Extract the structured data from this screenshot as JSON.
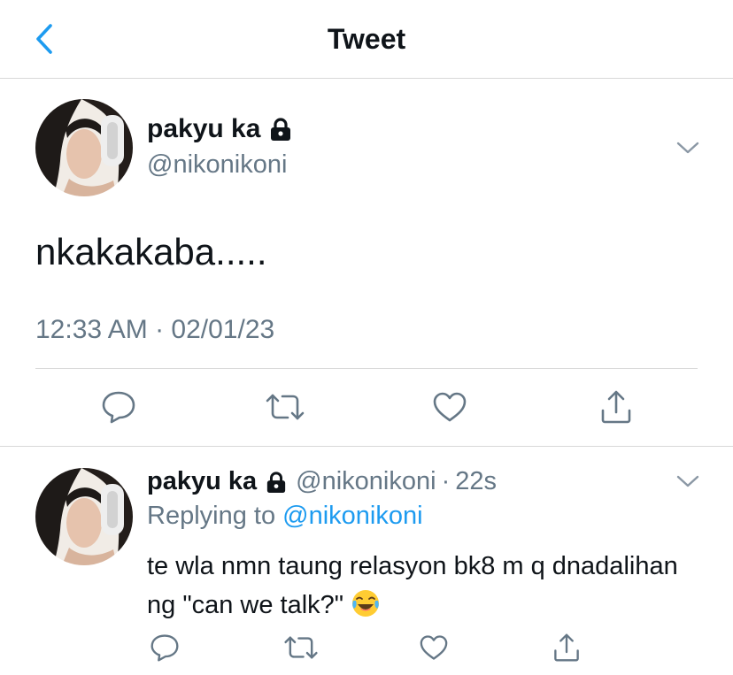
{
  "header": {
    "title": "Tweet",
    "back_icon": "chevron-left-icon"
  },
  "tweet": {
    "name": "pakyu ka",
    "handle": "@nikonikoni",
    "text": "nkakakaba.....",
    "timestamp": "12:33 AM · 02/01/23",
    "actions": [
      "reply-icon",
      "retweet-icon",
      "like-icon",
      "share-icon"
    ]
  },
  "reply": {
    "name": "pakyu ka",
    "handle": "@nikonikoni",
    "dot": "·",
    "time": "22s",
    "replying_prefix": "Replying to",
    "replying_to": "@nikonikoni",
    "text": "te wla nmn taung relasyon bk8 m q dnadalihan ng \"can we talk?\"",
    "emoji": "face-with-tears-of-joy"
  },
  "colors": {
    "accent": "#1d9bf0",
    "secondary_text": "#657786",
    "divider": "#d8d8d8"
  }
}
